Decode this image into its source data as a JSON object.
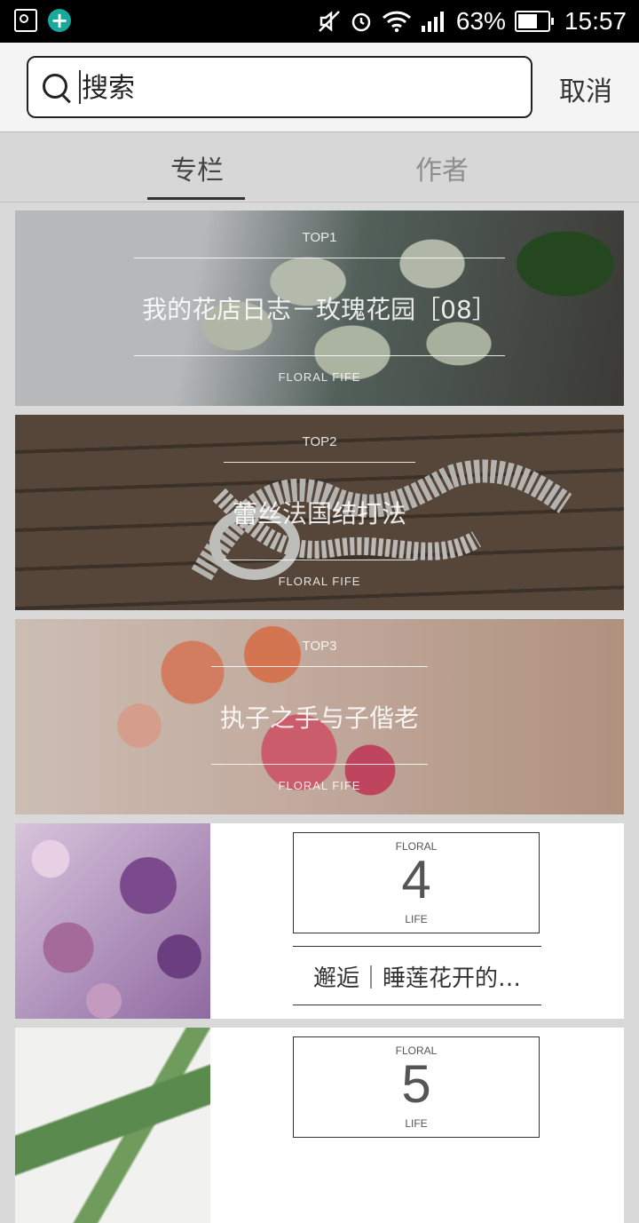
{
  "status_bar": {
    "battery": "63%",
    "time": "15:57",
    "icons_left": [
      "image-icon",
      "add-circle-icon"
    ],
    "icons_right": [
      "mute-icon",
      "alarm-icon",
      "wifi-icon",
      "signal-icon",
      "battery-icon"
    ]
  },
  "search": {
    "placeholder": "搜索",
    "value": "",
    "cancel_label": "取消"
  },
  "tabs": [
    {
      "label": "专栏",
      "active": true
    },
    {
      "label": "作者",
      "active": false
    }
  ],
  "banners": [
    {
      "rank": "TOP1",
      "title": "我的花店日志－玫瑰花园［08］",
      "footer": "FLORAL  FIFE"
    },
    {
      "rank": "TOP2",
      "title": "蕾丝法国结打法",
      "footer": "FLORAL  FIFE"
    },
    {
      "rank": "TOP3",
      "title": "执子之手与子偕老",
      "footer": "FLORAL  FIFE"
    }
  ],
  "list": [
    {
      "floral": "FLORAL",
      "number": "4",
      "life": "LIFE",
      "title": "邂逅｜睡莲花开的…"
    },
    {
      "floral": "FLORAL",
      "number": "5",
      "life": "LIFE",
      "title": ""
    }
  ],
  "colors": {
    "status_bar": "#000000",
    "accent_plus": "#1aa89c",
    "page_bg": "#d9d9d9",
    "tab_active": "#444444",
    "tab_inactive": "#8e8e8e"
  }
}
